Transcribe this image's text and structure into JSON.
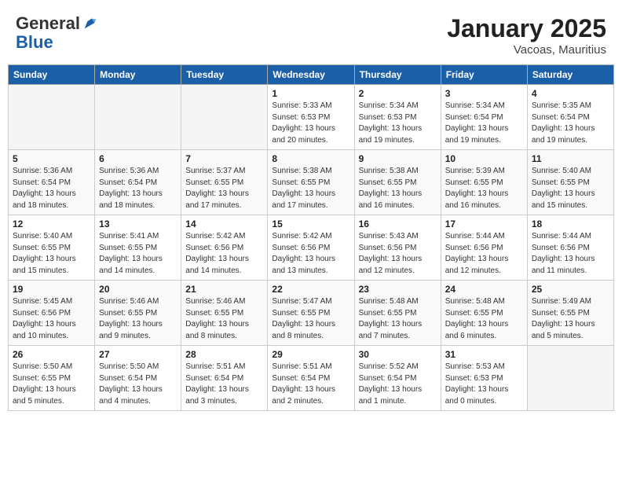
{
  "header": {
    "logo_general": "General",
    "logo_blue": "Blue",
    "month": "January 2025",
    "location": "Vacoas, Mauritius"
  },
  "weekdays": [
    "Sunday",
    "Monday",
    "Tuesday",
    "Wednesday",
    "Thursday",
    "Friday",
    "Saturday"
  ],
  "weeks": [
    [
      {
        "day": "",
        "info": ""
      },
      {
        "day": "",
        "info": ""
      },
      {
        "day": "",
        "info": ""
      },
      {
        "day": "1",
        "info": "Sunrise: 5:33 AM\nSunset: 6:53 PM\nDaylight: 13 hours\nand 20 minutes."
      },
      {
        "day": "2",
        "info": "Sunrise: 5:34 AM\nSunset: 6:53 PM\nDaylight: 13 hours\nand 19 minutes."
      },
      {
        "day": "3",
        "info": "Sunrise: 5:34 AM\nSunset: 6:54 PM\nDaylight: 13 hours\nand 19 minutes."
      },
      {
        "day": "4",
        "info": "Sunrise: 5:35 AM\nSunset: 6:54 PM\nDaylight: 13 hours\nand 19 minutes."
      }
    ],
    [
      {
        "day": "5",
        "info": "Sunrise: 5:36 AM\nSunset: 6:54 PM\nDaylight: 13 hours\nand 18 minutes."
      },
      {
        "day": "6",
        "info": "Sunrise: 5:36 AM\nSunset: 6:54 PM\nDaylight: 13 hours\nand 18 minutes."
      },
      {
        "day": "7",
        "info": "Sunrise: 5:37 AM\nSunset: 6:55 PM\nDaylight: 13 hours\nand 17 minutes."
      },
      {
        "day": "8",
        "info": "Sunrise: 5:38 AM\nSunset: 6:55 PM\nDaylight: 13 hours\nand 17 minutes."
      },
      {
        "day": "9",
        "info": "Sunrise: 5:38 AM\nSunset: 6:55 PM\nDaylight: 13 hours\nand 16 minutes."
      },
      {
        "day": "10",
        "info": "Sunrise: 5:39 AM\nSunset: 6:55 PM\nDaylight: 13 hours\nand 16 minutes."
      },
      {
        "day": "11",
        "info": "Sunrise: 5:40 AM\nSunset: 6:55 PM\nDaylight: 13 hours\nand 15 minutes."
      }
    ],
    [
      {
        "day": "12",
        "info": "Sunrise: 5:40 AM\nSunset: 6:55 PM\nDaylight: 13 hours\nand 15 minutes."
      },
      {
        "day": "13",
        "info": "Sunrise: 5:41 AM\nSunset: 6:55 PM\nDaylight: 13 hours\nand 14 minutes."
      },
      {
        "day": "14",
        "info": "Sunrise: 5:42 AM\nSunset: 6:56 PM\nDaylight: 13 hours\nand 14 minutes."
      },
      {
        "day": "15",
        "info": "Sunrise: 5:42 AM\nSunset: 6:56 PM\nDaylight: 13 hours\nand 13 minutes."
      },
      {
        "day": "16",
        "info": "Sunrise: 5:43 AM\nSunset: 6:56 PM\nDaylight: 13 hours\nand 12 minutes."
      },
      {
        "day": "17",
        "info": "Sunrise: 5:44 AM\nSunset: 6:56 PM\nDaylight: 13 hours\nand 12 minutes."
      },
      {
        "day": "18",
        "info": "Sunrise: 5:44 AM\nSunset: 6:56 PM\nDaylight: 13 hours\nand 11 minutes."
      }
    ],
    [
      {
        "day": "19",
        "info": "Sunrise: 5:45 AM\nSunset: 6:56 PM\nDaylight: 13 hours\nand 10 minutes."
      },
      {
        "day": "20",
        "info": "Sunrise: 5:46 AM\nSunset: 6:55 PM\nDaylight: 13 hours\nand 9 minutes."
      },
      {
        "day": "21",
        "info": "Sunrise: 5:46 AM\nSunset: 6:55 PM\nDaylight: 13 hours\nand 8 minutes."
      },
      {
        "day": "22",
        "info": "Sunrise: 5:47 AM\nSunset: 6:55 PM\nDaylight: 13 hours\nand 8 minutes."
      },
      {
        "day": "23",
        "info": "Sunrise: 5:48 AM\nSunset: 6:55 PM\nDaylight: 13 hours\nand 7 minutes."
      },
      {
        "day": "24",
        "info": "Sunrise: 5:48 AM\nSunset: 6:55 PM\nDaylight: 13 hours\nand 6 minutes."
      },
      {
        "day": "25",
        "info": "Sunrise: 5:49 AM\nSunset: 6:55 PM\nDaylight: 13 hours\nand 5 minutes."
      }
    ],
    [
      {
        "day": "26",
        "info": "Sunrise: 5:50 AM\nSunset: 6:55 PM\nDaylight: 13 hours\nand 5 minutes."
      },
      {
        "day": "27",
        "info": "Sunrise: 5:50 AM\nSunset: 6:54 PM\nDaylight: 13 hours\nand 4 minutes."
      },
      {
        "day": "28",
        "info": "Sunrise: 5:51 AM\nSunset: 6:54 PM\nDaylight: 13 hours\nand 3 minutes."
      },
      {
        "day": "29",
        "info": "Sunrise: 5:51 AM\nSunset: 6:54 PM\nDaylight: 13 hours\nand 2 minutes."
      },
      {
        "day": "30",
        "info": "Sunrise: 5:52 AM\nSunset: 6:54 PM\nDaylight: 13 hours\nand 1 minute."
      },
      {
        "day": "31",
        "info": "Sunrise: 5:53 AM\nSunset: 6:53 PM\nDaylight: 13 hours\nand 0 minutes."
      },
      {
        "day": "",
        "info": ""
      }
    ]
  ]
}
